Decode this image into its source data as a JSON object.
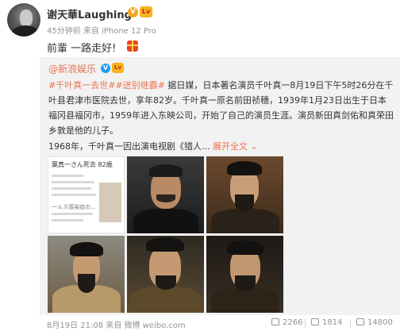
{
  "post": {
    "author": "谢天華Laughing",
    "v_badge": "V",
    "level_badge": "Lv",
    "meta": "45分钟前 来自 iPhone 12 Pro",
    "text": "前輩 一路走好!",
    "gift_icon": "gift-icon"
  },
  "repost": {
    "author": "@新浪娱乐",
    "v_badge": "V",
    "level_badge": "Lv",
    "tag1": "#千叶真一去世#",
    "tag2": "#送别继霸#",
    "body": " 据日媒，日本著名演员千叶真一8月19日下午5时26分在千叶县君津市医院去世，享年82岁。千叶真一原名前田祯穗，1939年1月23日出生于日本福冈县福冈市，1959年进入东映公司，开始了自己的演员生涯。演员新田真剑佑和真荣田乡敦是他的儿子。",
    "line2": "1968年，千叶真一因出演电视剧《猎人...",
    "expand": "展开全文",
    "expand_icon": "chevron-down-icon"
  },
  "images": {
    "news_thumb_title": "葉真一さん死去 82歳",
    "news_thumb_caption": "一ルス感染症の..."
  },
  "footer": {
    "date": "8月19日 21:08 来自 微博 weibo.com",
    "reposts": "2266",
    "comments": "1814",
    "likes": "14800"
  }
}
